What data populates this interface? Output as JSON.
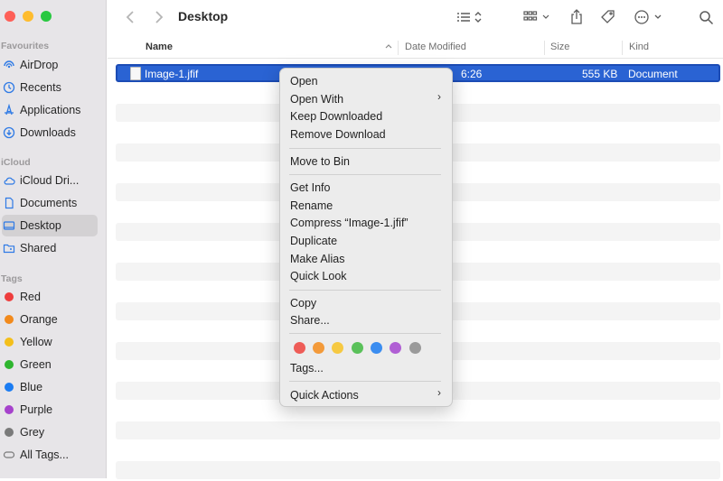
{
  "window": {
    "title": "Desktop",
    "traffic_colors": {
      "close": "#fe5f57",
      "minimize": "#febc2e",
      "zoom": "#28c840"
    }
  },
  "sidebar": {
    "favourites_label": "Favourites",
    "icloud_label": "iCloud",
    "tags_label": "Tags",
    "favourites": [
      {
        "label": "AirDrop",
        "icon": "airdrop-icon"
      },
      {
        "label": "Recents",
        "icon": "clock-icon"
      },
      {
        "label": "Applications",
        "icon": "applications-icon"
      },
      {
        "label": "Downloads",
        "icon": "download-icon"
      }
    ],
    "icloud": [
      {
        "label": "iCloud Dri...",
        "icon": "cloud-icon"
      },
      {
        "label": "Documents",
        "icon": "document-icon"
      },
      {
        "label": "Desktop",
        "icon": "desktop-icon",
        "active": true
      },
      {
        "label": "Shared",
        "icon": "shared-folder-icon"
      }
    ],
    "tags": [
      {
        "label": "Red",
        "color": "#ee3d3d"
      },
      {
        "label": "Orange",
        "color": "#f28a1c"
      },
      {
        "label": "Yellow",
        "color": "#f4bf1b"
      },
      {
        "label": "Green",
        "color": "#2fb52f"
      },
      {
        "label": "Blue",
        "color": "#1b7cf2"
      },
      {
        "label": "Purple",
        "color": "#a642cc"
      },
      {
        "label": "Grey",
        "color": "#7a7a7a"
      },
      {
        "label": "All Tags...",
        "icon": "all-tags-icon"
      }
    ]
  },
  "columns": {
    "name": "Name",
    "date_modified": "Date Modified",
    "size": "Size",
    "kind": "Kind"
  },
  "file": {
    "name": "Image-1.jfif",
    "date_fragment": "6:26",
    "size": "555 KB",
    "kind": "Document"
  },
  "context_menu": {
    "open": "Open",
    "open_with": "Open With",
    "keep_downloaded": "Keep Downloaded",
    "remove_download": "Remove Download",
    "move_to_bin": "Move to Bin",
    "get_info": "Get Info",
    "rename": "Rename",
    "compress": "Compress “Image-1.jfif”",
    "duplicate": "Duplicate",
    "make_alias": "Make Alias",
    "quick_look": "Quick Look",
    "copy": "Copy",
    "share": "Share...",
    "tags": "Tags...",
    "quick_actions": "Quick Actions",
    "submenu_arrow": "›",
    "tag_colors": [
      "#ee5c57",
      "#f39a3a",
      "#f6c942",
      "#5ac15a",
      "#3b8df0",
      "#b05fd4",
      "#9a9a9a"
    ]
  }
}
